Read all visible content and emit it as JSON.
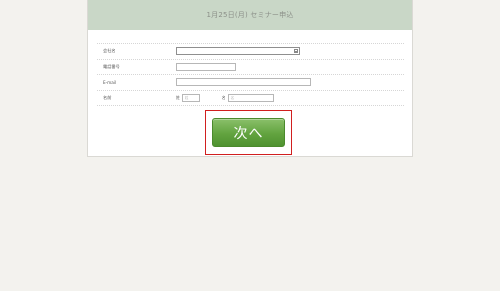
{
  "header": {
    "title": "1月25日(月) セミナー申込"
  },
  "form": {
    "company": {
      "label": "会社名",
      "value": ""
    },
    "phone": {
      "label": "電話番号",
      "value": ""
    },
    "email": {
      "label": "E-mail",
      "value": ""
    },
    "name": {
      "label": "名前",
      "last_label": "姓",
      "last_placeholder": "姓",
      "first_label": "名",
      "first_placeholder": "名"
    }
  },
  "actions": {
    "next_label": "次へ",
    "highlight_color": "#d11f1f",
    "button_color": "#62a33f"
  }
}
